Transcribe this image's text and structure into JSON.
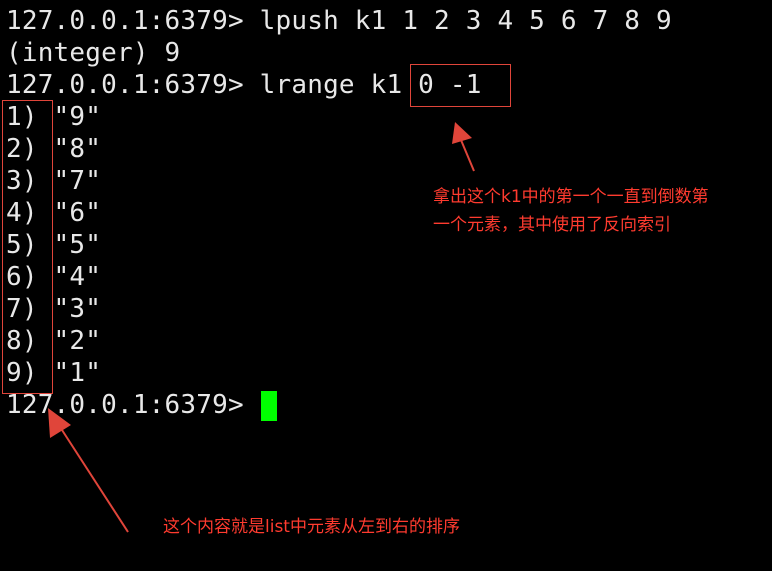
{
  "terminal": {
    "lines": [
      "127.0.0.1:6379> lpush k1 1 2 3 4 5 6 7 8 9",
      "(integer) 9",
      "127.0.0.1:6379> lrange k1 0 -1",
      "1) \"9\"",
      "2) \"8\"",
      "3) \"7\"",
      "4) \"6\"",
      "5) \"5\"",
      "6) \"4\"",
      "7) \"3\"",
      "8) \"2\"",
      "9) \"1\"",
      "127.0.0.1:6379> "
    ]
  },
  "annotations": {
    "range_note": "拿出这个k1中的第一个一直到倒数第\n一个元素，其中使用了反向索引",
    "order_note": "这个内容就是list中元素从左到右的排序"
  },
  "colors": {
    "background": "#000000",
    "text": "#e8e8e8",
    "cursor": "#00ff00",
    "annotation": "#ff3b2f"
  }
}
